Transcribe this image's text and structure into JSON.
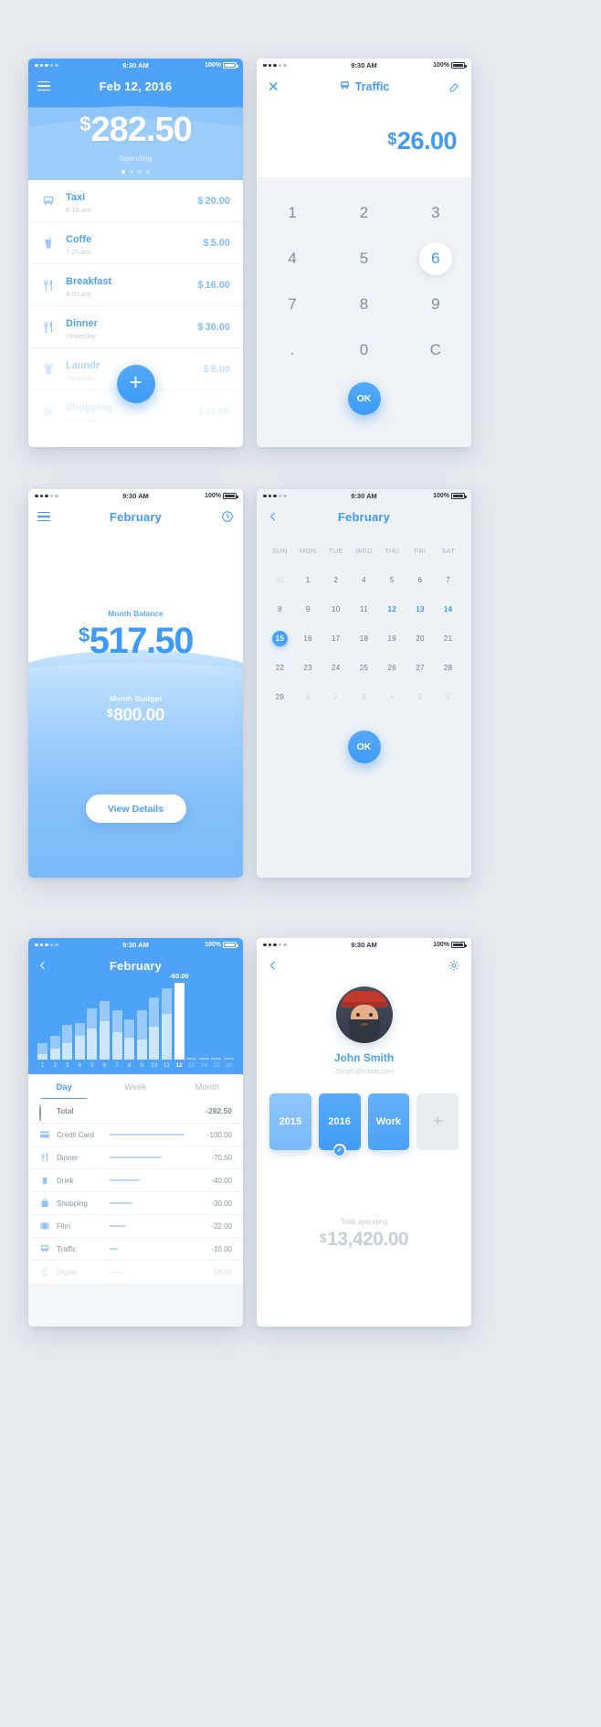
{
  "statusbar": {
    "time": "9:30 AM",
    "battery": "100%"
  },
  "screen1": {
    "name": "spending-overview",
    "menu_icon": "hamburger-icon",
    "date_title": "Feb 12, 2016",
    "amount": "282.50",
    "currency": "$",
    "sub_label": "Spending",
    "page_dots": 4,
    "active_dot": 0,
    "add_button": "+",
    "transactions": [
      {
        "icon": "bus-icon",
        "name": "Taxi",
        "time": "8:10 am",
        "amount": "20.00",
        "currency": "$"
      },
      {
        "icon": "cup-icon",
        "name": "Coffe",
        "time": "7:25 am",
        "amount": "5.00",
        "currency": "$"
      },
      {
        "icon": "cutlery-icon",
        "name": "Breakfast",
        "time": "8:00 am",
        "amount": "16.00",
        "currency": "$"
      },
      {
        "icon": "cutlery-icon",
        "name": "Dinner",
        "time": "Yesterday",
        "amount": "30.00",
        "currency": "$"
      },
      {
        "icon": "shirt-icon",
        "name": "Laundr",
        "time": "Yesterday",
        "amount": "8.00",
        "currency": "$"
      },
      {
        "icon": "bag-icon",
        "name": "Shopping",
        "time": "Yesterday",
        "amount": "15.00",
        "currency": "$"
      }
    ]
  },
  "screen2": {
    "name": "amount-entry-keypad",
    "close_icon": "close-icon",
    "title": "Traffic",
    "title_icon": "bus-icon",
    "edit_icon": "edit-icon",
    "amount": "26.00",
    "currency": "$",
    "keys": [
      [
        "1",
        "2",
        "3"
      ],
      [
        "4",
        "5",
        "6"
      ],
      [
        "7",
        "8",
        "9"
      ],
      [
        ".",
        "0",
        "C"
      ]
    ],
    "selected_key": "6",
    "ok_label": "OK"
  },
  "screen3": {
    "name": "month-balance",
    "menu_icon": "hamburger-icon",
    "title": "February",
    "clock_icon": "clock-icon",
    "balance_label": "Month Balance",
    "balance": "517.50",
    "budget_label": "Month Budget",
    "budget": "800.00",
    "currency": "$",
    "details_button": "View Details"
  },
  "screen4": {
    "name": "calendar-picker",
    "back_icon": "chevron-left-icon",
    "title": "February",
    "weekdays": [
      "SUN",
      "MON",
      "TUE",
      "WED",
      "THU",
      "FRI",
      "SAT"
    ],
    "weeks": [
      [
        {
          "d": "31",
          "s": "mut"
        },
        {
          "d": "1",
          "s": ""
        },
        {
          "d": "2",
          "s": ""
        },
        {
          "d": "4",
          "s": ""
        },
        {
          "d": "5",
          "s": ""
        },
        {
          "d": "6",
          "s": ""
        },
        {
          "d": "7",
          "s": ""
        }
      ],
      [
        {
          "d": "8",
          "s": ""
        },
        {
          "d": "9",
          "s": ""
        },
        {
          "d": "10",
          "s": ""
        },
        {
          "d": "11",
          "s": ""
        },
        {
          "d": "12",
          "s": "hl"
        },
        {
          "d": "13",
          "s": "hl"
        },
        {
          "d": "14",
          "s": "hl"
        }
      ],
      [
        {
          "d": "15",
          "s": "sel"
        },
        {
          "d": "16",
          "s": ""
        },
        {
          "d": "17",
          "s": ""
        },
        {
          "d": "18",
          "s": ""
        },
        {
          "d": "19",
          "s": ""
        },
        {
          "d": "20",
          "s": ""
        },
        {
          "d": "21",
          "s": ""
        }
      ],
      [
        {
          "d": "22",
          "s": ""
        },
        {
          "d": "23",
          "s": ""
        },
        {
          "d": "24",
          "s": ""
        },
        {
          "d": "25",
          "s": ""
        },
        {
          "d": "26",
          "s": ""
        },
        {
          "d": "27",
          "s": ""
        },
        {
          "d": "28",
          "s": ""
        }
      ],
      [
        {
          "d": "29",
          "s": ""
        },
        {
          "d": "1",
          "s": "mut"
        },
        {
          "d": "2",
          "s": "mut"
        },
        {
          "d": "3",
          "s": "mut"
        },
        {
          "d": "4",
          "s": "mut"
        },
        {
          "d": "5",
          "s": "mut"
        },
        {
          "d": "6",
          "s": "mut"
        }
      ]
    ],
    "ok_label": "OK"
  },
  "screen5": {
    "name": "statistics",
    "back_icon": "chevron-left-icon",
    "title": "February",
    "tabs": [
      {
        "label": "Day",
        "active": true
      },
      {
        "label": "Week",
        "active": false
      },
      {
        "label": "Month",
        "active": false
      }
    ],
    "breakdown": [
      {
        "icon": "circle-icon",
        "name": "Total",
        "value": "-282.50",
        "pct": 0
      },
      {
        "icon": "creditcard-icon",
        "name": "Credit Card",
        "value": "-100.00",
        "pct": 100
      },
      {
        "icon": "cutlery-icon",
        "name": "Dinner",
        "value": "-70.50",
        "pct": 70
      },
      {
        "icon": "cup-icon",
        "name": "Drink",
        "value": "-40.00",
        "pct": 40
      },
      {
        "icon": "bag-icon",
        "name": "Shopping",
        "value": "-30.00",
        "pct": 30
      },
      {
        "icon": "film-icon",
        "name": "Film",
        "value": "-22.00",
        "pct": 22
      },
      {
        "icon": "bus-icon",
        "name": "Traffic",
        "value": "-10.00",
        "pct": 11
      },
      {
        "icon": "digital-icon",
        "name": "Digital",
        "value": "-18.00",
        "pct": 18
      }
    ]
  },
  "screen6": {
    "name": "profile",
    "back_icon": "chevron-left-icon",
    "settings_icon": "gear-icon",
    "avatar": "user-avatar",
    "user_name": "John Smith",
    "user_email": "JSmith@smith.com",
    "year_cards": [
      {
        "label": "2015",
        "selected": false
      },
      {
        "label": "2016",
        "selected": true
      },
      {
        "label": "Work",
        "selected": false
      }
    ],
    "add_card": "+",
    "total_label": "Total spending",
    "total_value": "13,420.00",
    "currency": "$"
  },
  "chart_data": {
    "type": "bar",
    "title": "February",
    "xlabel": "",
    "ylabel": "",
    "annotation": "-60.00",
    "highlight_index": 11,
    "categories": [
      "1",
      "2",
      "3",
      "4",
      "5",
      "6",
      "7",
      "8",
      "9",
      "10",
      "11",
      "12",
      "13",
      "14",
      "15",
      "16"
    ],
    "series": [
      {
        "name": "lower",
        "values": [
          6,
          12,
          18,
          26,
          34,
          42,
          30,
          24,
          22,
          36,
          50,
          88,
          2,
          2,
          2,
          2
        ]
      },
      {
        "name": "upper",
        "values": [
          18,
          26,
          38,
          40,
          56,
          64,
          54,
          44,
          54,
          68,
          78,
          88,
          2,
          2,
          2,
          2
        ]
      }
    ]
  }
}
